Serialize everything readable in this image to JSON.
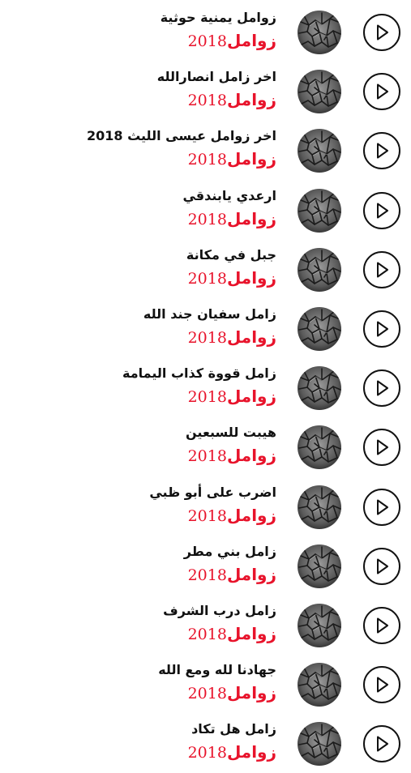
{
  "subtitle": {
    "word": "زوامل",
    "year": "2018"
  },
  "icons": {
    "thumbnail": "cracked-stone-thumbnail",
    "play": "play-icon"
  },
  "colors": {
    "accent": "#e8132b",
    "title": "#111111",
    "thumb_dark": "#2a2a2a"
  },
  "tracks": [
    {
      "title": "زوامل يمنية حوثية"
    },
    {
      "title": "اخر زامل انصارالله"
    },
    {
      "title": "اخر زوامل عيسى الليث 2018"
    },
    {
      "title": "ارعدي يابندقي"
    },
    {
      "title": "جبل في مكانة"
    },
    {
      "title": "زامل سفيان جند الله"
    },
    {
      "title": "زامل قووة  كذاب اليمامة"
    },
    {
      "title": "هيبت للسبعين"
    },
    {
      "title": "اضرب على أبو ظبي"
    },
    {
      "title": "زامل بني مطر"
    },
    {
      "title": "زامل درب الشرف"
    },
    {
      "title": "جهادنا لله ومع الله"
    },
    {
      "title": "زامل هل تكاد"
    }
  ]
}
